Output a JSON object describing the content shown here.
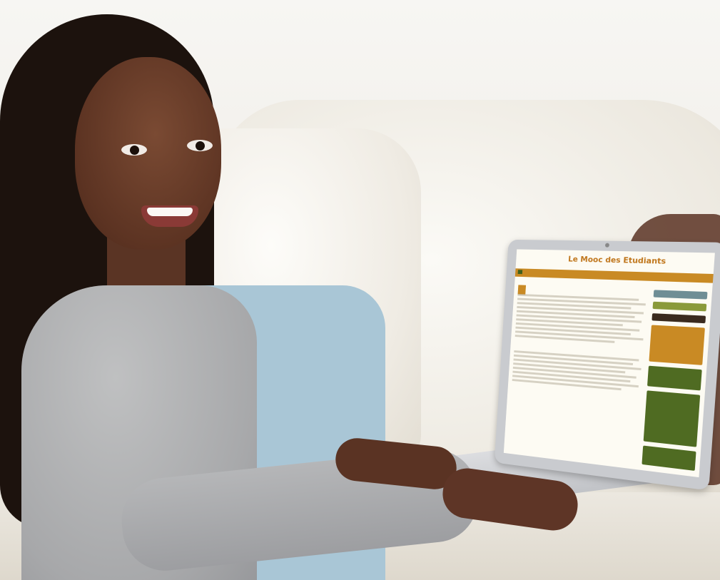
{
  "screen": {
    "site_title": "Le Mooc des Etudiants",
    "colors": {
      "accent": "#c98a24",
      "green": "#4f6b22",
      "title": "#c0761b"
    }
  }
}
